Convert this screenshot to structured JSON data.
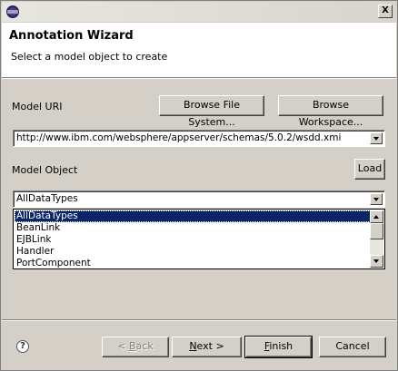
{
  "window": {
    "title": "",
    "close_glyph": "X"
  },
  "banner": {
    "title": "Annotation Wizard",
    "message": "Select a model object to create"
  },
  "model_uri": {
    "label": "Model URI",
    "browse_fs_label": "Browse File System...",
    "browse_ws_label": "Browse Workspace...",
    "value": "http://www.ibm.com/websphere/appserver/schemas/5.0.2/wsdd.xmi"
  },
  "model_object": {
    "label": "Model Object",
    "load_label": "Load",
    "selected": "AllDataTypes",
    "options": [
      "AllDataTypes",
      "BeanLink",
      "EJBLink",
      "Handler",
      "PortComponent"
    ],
    "selected_index": 0
  },
  "footer": {
    "help_glyph": "?",
    "back_prefix": "< ",
    "back_mnemonic": "B",
    "back_rest": "ack",
    "next_mnemonic": "N",
    "next_rest": "ext >",
    "finish_mnemonic": "F",
    "finish_rest": "inish",
    "cancel_label": "Cancel"
  },
  "icons": {
    "title": "eclipse-logo-icon",
    "help": "help-icon"
  }
}
